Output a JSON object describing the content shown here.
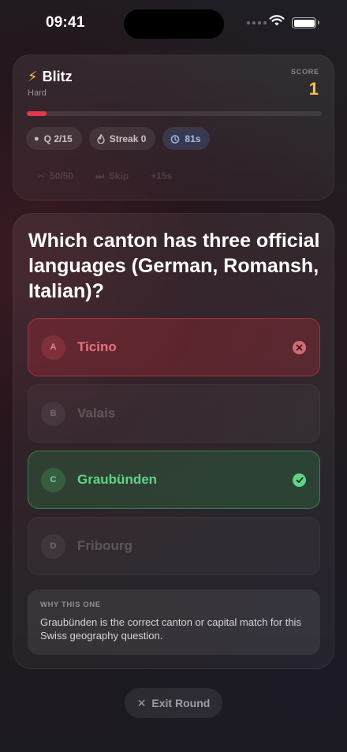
{
  "status_bar": {
    "time": "09:41"
  },
  "header": {
    "mode_icon": "lightning-bolt-icon",
    "mode": "Blitz",
    "difficulty": "Hard",
    "score_label": "SCORE",
    "score": "1",
    "progress": 0.067,
    "progress_color": "#e0394a",
    "chips": {
      "question": "Q 2/15",
      "streak": "Streak 0",
      "timer": "81s"
    },
    "lifelines": {
      "fifty": "50/50",
      "skip": "Skip",
      "time": "+15s"
    }
  },
  "question": {
    "text": "Which canton has three official languages (German, Romansh, Italian)?",
    "options": [
      {
        "letter": "A",
        "text": "Ticino",
        "state": "wrong"
      },
      {
        "letter": "B",
        "text": "Valais",
        "state": "dimmed"
      },
      {
        "letter": "C",
        "text": "Graubünden",
        "state": "correct"
      },
      {
        "letter": "D",
        "text": "Fribourg",
        "state": "dimmed"
      }
    ],
    "explanation_title": "WHY THIS ONE",
    "explanation": "Graubünden is the correct canton or capital match for this Swiss geography question."
  },
  "exit_label": "Exit Round",
  "colors": {
    "accent_gold": "#f3c547",
    "wrong": "#e5737b",
    "correct": "#5fd487",
    "timer": "#9ec1f5"
  }
}
